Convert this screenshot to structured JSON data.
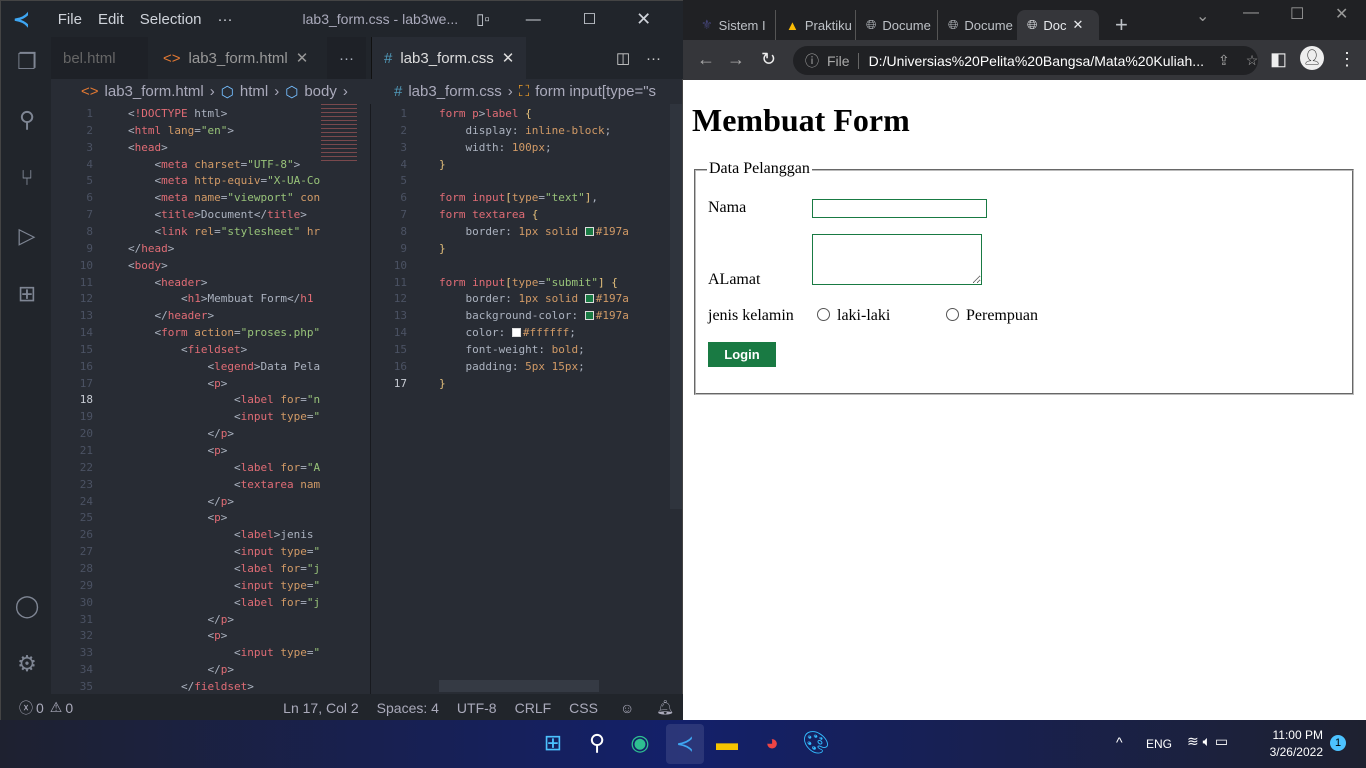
{
  "vscode": {
    "menu": [
      "File",
      "Edit",
      "Selection",
      "···"
    ],
    "window_title": "lab3_form.css - lab3we...",
    "left_tabs": [
      {
        "label": "bel.html"
      },
      {
        "label": "lab3_form.html"
      }
    ],
    "right_tab": {
      "label": "lab3_form.css"
    },
    "more": "···",
    "left_crumb": [
      "lab3_form.html",
      "html",
      "body"
    ],
    "right_crumb": [
      "lab3_form.css",
      "form input[type=\"s"
    ],
    "html_lines": [
      [
        [
          "p",
          "<"
        ],
        [
          "t",
          "!DOCTYPE"
        ],
        [
          "x",
          " html"
        ],
        [
          "p",
          ">"
        ]
      ],
      [
        [
          "p",
          "<"
        ],
        [
          "t",
          "html"
        ],
        [
          "a",
          " lang"
        ],
        [
          "p",
          "="
        ],
        [
          "s",
          "\"en\""
        ],
        [
          "p",
          ">"
        ]
      ],
      [
        [
          "p",
          "<"
        ],
        [
          "t",
          "head"
        ],
        [
          "p",
          ">"
        ]
      ],
      [
        [
          "x",
          "    "
        ],
        [
          "p",
          "<"
        ],
        [
          "t",
          "meta"
        ],
        [
          "a",
          " charset"
        ],
        [
          "p",
          "="
        ],
        [
          "s",
          "\"UTF-8\""
        ],
        [
          "p",
          ">"
        ]
      ],
      [
        [
          "x",
          "    "
        ],
        [
          "p",
          "<"
        ],
        [
          "t",
          "meta"
        ],
        [
          "a",
          " http-equiv"
        ],
        [
          "p",
          "="
        ],
        [
          "s",
          "\"X-UA-Co"
        ]
      ],
      [
        [
          "x",
          "    "
        ],
        [
          "p",
          "<"
        ],
        [
          "t",
          "meta"
        ],
        [
          "a",
          " name"
        ],
        [
          "p",
          "="
        ],
        [
          "s",
          "\"viewport\""
        ],
        [
          "a",
          " con"
        ]
      ],
      [
        [
          "x",
          "    "
        ],
        [
          "p",
          "<"
        ],
        [
          "t",
          "title"
        ],
        [
          "p",
          ">"
        ],
        [
          "x",
          "Document"
        ],
        [
          "p",
          "</"
        ],
        [
          "t",
          "title"
        ],
        [
          "p",
          ">"
        ]
      ],
      [
        [
          "x",
          "    "
        ],
        [
          "p",
          "<"
        ],
        [
          "t",
          "link"
        ],
        [
          "a",
          " rel"
        ],
        [
          "p",
          "="
        ],
        [
          "s",
          "\"stylesheet\""
        ],
        [
          "a",
          " hr"
        ]
      ],
      [
        [
          "p",
          "</"
        ],
        [
          "t",
          "head"
        ],
        [
          "p",
          ">"
        ]
      ],
      [
        [
          "p",
          "<"
        ],
        [
          "t",
          "body"
        ],
        [
          "p",
          ">"
        ]
      ],
      [
        [
          "x",
          "    "
        ],
        [
          "p",
          "<"
        ],
        [
          "t",
          "header"
        ],
        [
          "p",
          ">"
        ]
      ],
      [
        [
          "x",
          "        "
        ],
        [
          "p",
          "<"
        ],
        [
          "t",
          "h1"
        ],
        [
          "p",
          ">"
        ],
        [
          "x",
          "Membuat Form"
        ],
        [
          "p",
          "</"
        ],
        [
          "t",
          "h1"
        ]
      ],
      [
        [
          "x",
          "    "
        ],
        [
          "p",
          "</"
        ],
        [
          "t",
          "header"
        ],
        [
          "p",
          ">"
        ]
      ],
      [
        [
          "x",
          "    "
        ],
        [
          "p",
          "<"
        ],
        [
          "t",
          "form"
        ],
        [
          "a",
          " action"
        ],
        [
          "p",
          "="
        ],
        [
          "s",
          "\"proses.php\""
        ]
      ],
      [
        [
          "x",
          "        "
        ],
        [
          "p",
          "<"
        ],
        [
          "t",
          "fieldset"
        ],
        [
          "p",
          ">"
        ]
      ],
      [
        [
          "x",
          "            "
        ],
        [
          "p",
          "<"
        ],
        [
          "t",
          "legend"
        ],
        [
          "p",
          ">"
        ],
        [
          "x",
          "Data Pela"
        ]
      ],
      [
        [
          "x",
          "            "
        ],
        [
          "p",
          "<"
        ],
        [
          "t",
          "p"
        ],
        [
          "p",
          ">"
        ]
      ],
      [
        [
          "x",
          "                "
        ],
        [
          "p",
          "<"
        ],
        [
          "t",
          "label"
        ],
        [
          "a",
          " for"
        ],
        [
          "p",
          "="
        ],
        [
          "s",
          "\"n"
        ]
      ],
      [
        [
          "x",
          "                "
        ],
        [
          "p",
          "<"
        ],
        [
          "t",
          "input"
        ],
        [
          "a",
          " type"
        ],
        [
          "p",
          "="
        ],
        [
          "s",
          "\""
        ]
      ],
      [
        [
          "x",
          "            "
        ],
        [
          "p",
          "</"
        ],
        [
          "t",
          "p"
        ],
        [
          "p",
          ">"
        ]
      ],
      [
        [
          "x",
          "            "
        ],
        [
          "p",
          "<"
        ],
        [
          "t",
          "p"
        ],
        [
          "p",
          ">"
        ]
      ],
      [
        [
          "x",
          "                "
        ],
        [
          "p",
          "<"
        ],
        [
          "t",
          "label"
        ],
        [
          "a",
          " for"
        ],
        [
          "p",
          "="
        ],
        [
          "s",
          "\"A"
        ]
      ],
      [
        [
          "x",
          "                "
        ],
        [
          "p",
          "<"
        ],
        [
          "t",
          "textarea"
        ],
        [
          "a",
          " nam"
        ]
      ],
      [
        [
          "x",
          "            "
        ],
        [
          "p",
          "</"
        ],
        [
          "t",
          "p"
        ],
        [
          "p",
          ">"
        ]
      ],
      [
        [
          "x",
          "            "
        ],
        [
          "p",
          "<"
        ],
        [
          "t",
          "p"
        ],
        [
          "p",
          ">"
        ]
      ],
      [
        [
          "x",
          "                "
        ],
        [
          "p",
          "<"
        ],
        [
          "t",
          "label"
        ],
        [
          "p",
          ">"
        ],
        [
          "x",
          "jenis"
        ]
      ],
      [
        [
          "x",
          "                "
        ],
        [
          "p",
          "<"
        ],
        [
          "t",
          "input"
        ],
        [
          "a",
          " type"
        ],
        [
          "p",
          "="
        ],
        [
          "s",
          "\""
        ]
      ],
      [
        [
          "x",
          "                "
        ],
        [
          "p",
          "<"
        ],
        [
          "t",
          "label"
        ],
        [
          "a",
          " for"
        ],
        [
          "p",
          "="
        ],
        [
          "s",
          "\"j"
        ]
      ],
      [
        [
          "x",
          "                "
        ],
        [
          "p",
          "<"
        ],
        [
          "t",
          "input"
        ],
        [
          "a",
          " type"
        ],
        [
          "p",
          "="
        ],
        [
          "s",
          "\""
        ]
      ],
      [
        [
          "x",
          "                "
        ],
        [
          "p",
          "<"
        ],
        [
          "t",
          "label"
        ],
        [
          "a",
          " for"
        ],
        [
          "p",
          "="
        ],
        [
          "s",
          "\"j"
        ]
      ],
      [
        [
          "x",
          "            "
        ],
        [
          "p",
          "</"
        ],
        [
          "t",
          "p"
        ],
        [
          "p",
          ">"
        ]
      ],
      [
        [
          "x",
          "            "
        ],
        [
          "p",
          "<"
        ],
        [
          "t",
          "p"
        ],
        [
          "p",
          ">"
        ]
      ],
      [
        [
          "x",
          "                "
        ],
        [
          "p",
          "<"
        ],
        [
          "t",
          "input"
        ],
        [
          "a",
          " type"
        ],
        [
          "p",
          "="
        ],
        [
          "s",
          "\""
        ]
      ],
      [
        [
          "x",
          "            "
        ],
        [
          "p",
          "</"
        ],
        [
          "t",
          "p"
        ],
        [
          "p",
          ">"
        ]
      ],
      [
        [
          "x",
          "        "
        ],
        [
          "p",
          "</"
        ],
        [
          "t",
          "fieldset"
        ],
        [
          "p",
          ">"
        ]
      ]
    ],
    "css_lines": [
      [
        [
          "t",
          "form p"
        ],
        [
          "p",
          ">"
        ],
        [
          "t",
          "label"
        ],
        [
          "y",
          " {"
        ]
      ],
      [
        [
          "x",
          "    display: "
        ],
        [
          "n",
          "inline-block"
        ],
        [
          "p",
          ";"
        ]
      ],
      [
        [
          "x",
          "    width: "
        ],
        [
          "n",
          "100px"
        ],
        [
          "p",
          ";"
        ]
      ],
      [
        [
          "y",
          "}"
        ]
      ],
      [],
      [
        [
          "t",
          "form input"
        ],
        [
          "y",
          "["
        ],
        [
          "a",
          "type"
        ],
        [
          "p",
          "="
        ],
        [
          "s",
          "\"text\""
        ],
        [
          "y",
          "]"
        ],
        [
          "p",
          ","
        ]
      ],
      [
        [
          "t",
          "form textarea"
        ],
        [
          "y",
          " {"
        ]
      ],
      [
        [
          "x",
          "    border: "
        ],
        [
          "n",
          "1px solid "
        ],
        [
          "sw",
          "#197a43"
        ],
        [
          "n",
          "#197a"
        ]
      ],
      [
        [
          "y",
          "}"
        ]
      ],
      [],
      [
        [
          "t",
          "form input"
        ],
        [
          "y",
          "["
        ],
        [
          "a",
          "type"
        ],
        [
          "p",
          "="
        ],
        [
          "s",
          "\"submit\""
        ],
        [
          "y",
          "] {"
        ]
      ],
      [
        [
          "x",
          "    border: "
        ],
        [
          "n",
          "1px solid "
        ],
        [
          "sw",
          "#197a43"
        ],
        [
          "n",
          "#197a"
        ]
      ],
      [
        [
          "x",
          "    background-color: "
        ],
        [
          "sw",
          "#197a43"
        ],
        [
          "n",
          "#197a"
        ]
      ],
      [
        [
          "x",
          "    color: "
        ],
        [
          "sw",
          "#ffffff"
        ],
        [
          "n",
          "#ffffff"
        ],
        [
          "p",
          ";"
        ]
      ],
      [
        [
          "x",
          "    font-weight: "
        ],
        [
          "n",
          "bold"
        ],
        [
          "p",
          ";"
        ]
      ],
      [
        [
          "x",
          "    padding: "
        ],
        [
          "n",
          "5px 15px"
        ],
        [
          "p",
          ";"
        ]
      ],
      [
        [
          "y",
          "}"
        ]
      ]
    ],
    "status": {
      "errors": "0",
      "warnings": "0",
      "position": "Ln 17, Col 2",
      "spaces": "Spaces: 4",
      "encoding": "UTF-8",
      "eol": "CRLF",
      "language": "CSS"
    }
  },
  "browser": {
    "tabs": [
      {
        "label": "Sistem I"
      },
      {
        "label": "Praktiku"
      },
      {
        "label": "Docume"
      },
      {
        "label": "Docume"
      },
      {
        "label": "Doc"
      }
    ],
    "new_tab": "+",
    "scheme_label": "File",
    "url": "D:/Universias%20Pelita%20Bangsa/Mata%20Kuliah...",
    "page": {
      "heading": "Membuat Form",
      "legend": "Data Pelanggan",
      "nama_label": "Nama",
      "nama_value": "",
      "alamat_label": "ALamat",
      "alamat_value": "",
      "gender_label": "jenis kelamin",
      "gender_options": [
        "laki-laki",
        "Perempuan"
      ],
      "submit": "Login",
      "accent": "#197a43"
    }
  },
  "taskbar": {
    "lang": "ENG",
    "time": "11:00 PM",
    "date": "3/26/2022",
    "notifications": "1"
  }
}
